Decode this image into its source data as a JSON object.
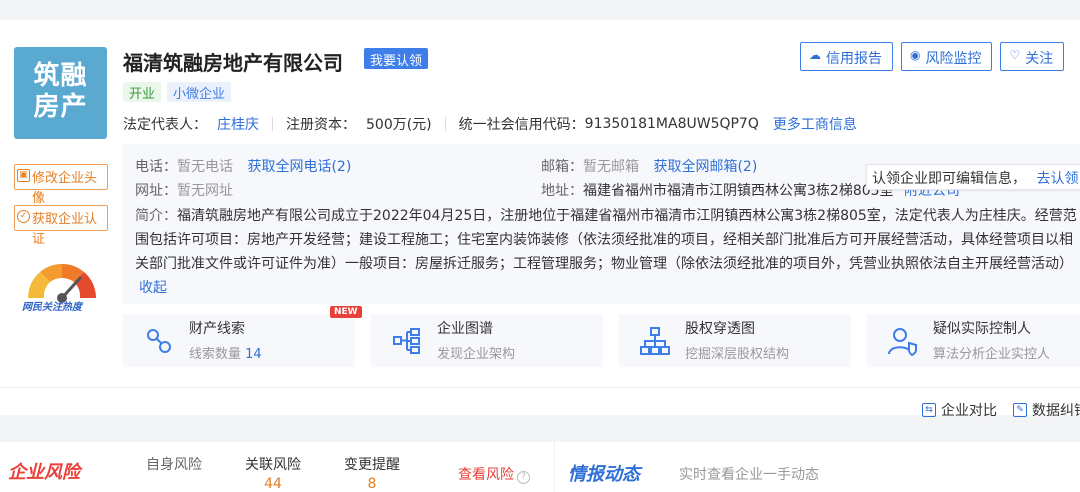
{
  "company": {
    "logo_line1": "筑融",
    "logo_line2": "房产",
    "name": "福清筑融房地产有限公司",
    "claim_label": "我要认领",
    "tags": [
      "开业",
      "小微企业"
    ],
    "legal_rep_label": "法定代表人：",
    "legal_rep": "庄桂庆",
    "capital_label": "注册资本：",
    "capital": "500万(元)",
    "credit_code_label": "统一社会信用代码：",
    "credit_code": "91350181MA8UW5QP7Q",
    "more_info": "更多工商信息"
  },
  "sidebar": {
    "edit_logo": "修改企业头像",
    "get_cert": "获取企业认证",
    "heat_label": "网民关注热度"
  },
  "actions": {
    "credit_report": "信用报告",
    "risk_monitor": "风险监控",
    "follow": "关注"
  },
  "contact": {
    "phone_label": "电话：",
    "phone_value": "暂无电话",
    "phone_link": "获取全网电话(2)",
    "email_label": "邮箱：",
    "email_value": "暂无邮箱",
    "email_link": "获取全网邮箱(2)",
    "website_label": "网址：",
    "website_value": "暂无网址",
    "address_label": "地址：",
    "address_value": "福建省福州市福清市江阴镇西林公寓3栋2梯805室",
    "nearby_link": "附近公司",
    "intro_label": "简介：",
    "intro_text": "福清筑融房地产有限公司成立于2022年04月25日，注册地位于福建省福州市福清市江阴镇西林公寓3栋2梯805室，法定代表人为庄桂庆。经营范围包括许可项目：房地产开发经营；建设工程施工；住宅室内装饰装修（依法须经批准的项目，经相关部门批准后方可开展经营活动，具体经营项目以相关部门批准文件或许可证件为准）一般项目：房屋拆迁服务；工程管理服务；物业管理（除依法须经批准的项目外，凭营业执照依法自主开展经营活动）",
    "collapse_link": "收起"
  },
  "notice": {
    "text": "认领企业即可编辑信息，",
    "link": "去认领"
  },
  "features": [
    {
      "name": "财产线索",
      "sub_label": "线索数量 ",
      "sub_value": "14",
      "badge": "NEW"
    },
    {
      "name": "企业图谱",
      "sub_label": "发现企业架构"
    },
    {
      "name": "股权穿透图",
      "sub_label": "挖掘深层股权结构"
    },
    {
      "name": "疑似实际控制人",
      "sub_label": "算法分析企业实控人"
    }
  ],
  "tools": {
    "compare": "企业对比",
    "data": "数据纠错"
  },
  "risk": {
    "title": "企业风险",
    "items": [
      {
        "label": "自身风险",
        "value": ""
      },
      {
        "label": "关联风险",
        "value": "44"
      },
      {
        "label": "变更提醒",
        "value": "8"
      }
    ],
    "view_label": "查看风险",
    "intel_title": "情报动态",
    "intel_sub": "实时查看企业一手动态"
  },
  "colors": {
    "accent": "#3e7ee8",
    "link": "#2f6fd8",
    "warning": "#e67e22",
    "danger": "#e9403a"
  }
}
